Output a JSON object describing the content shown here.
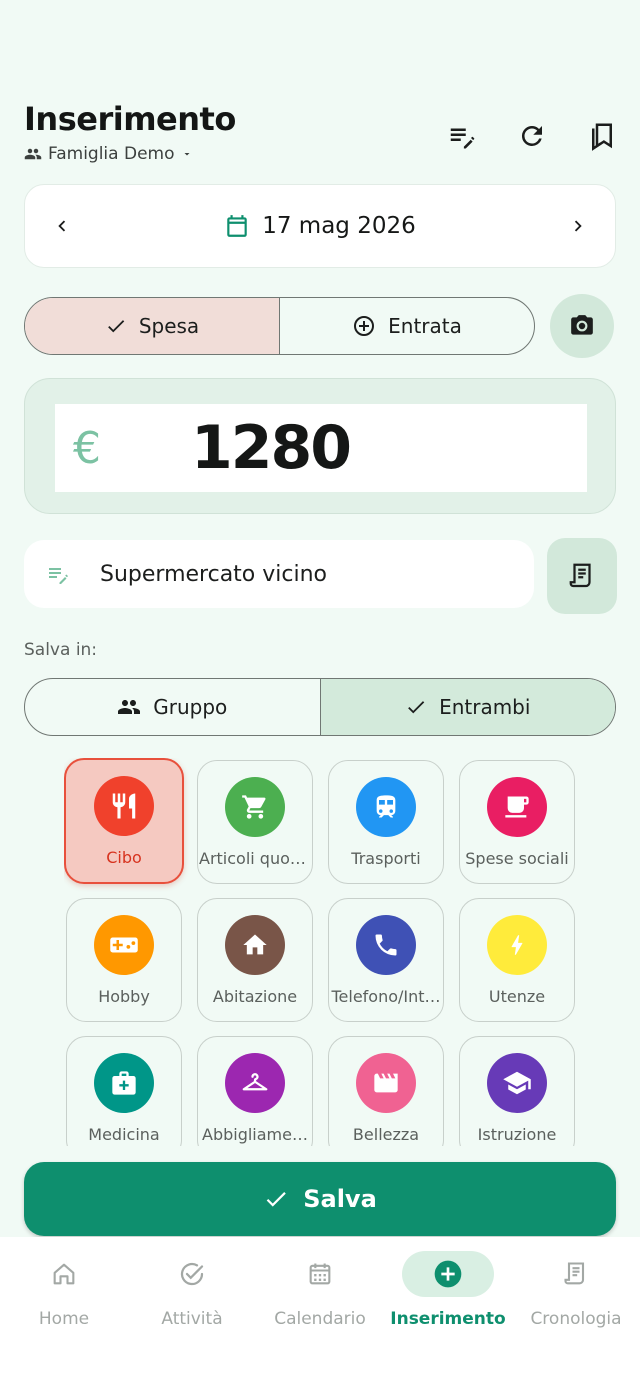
{
  "header": {
    "title": "Inserimento",
    "group_name": "Famiglia Demo"
  },
  "date_selector": {
    "date": "17 mag 2026"
  },
  "type_toggle": {
    "expense_label": "Spesa",
    "income_label": "Entrata",
    "selected": "Spesa"
  },
  "amount": {
    "currency": "€",
    "value": "1280"
  },
  "note": {
    "value": "Supermercato vicino"
  },
  "save_in": {
    "label": "Salva in:",
    "group_label": "Gruppo",
    "both_label": "Entrambi",
    "selected": "Entrambi"
  },
  "categories": [
    {
      "label": "Cibo",
      "icon": "restaurant-icon",
      "color": "#f0412c",
      "selected": true
    },
    {
      "label": "Articoli quot…",
      "icon": "cart-icon",
      "color": "#4caf50"
    },
    {
      "label": "Trasporti",
      "icon": "train-icon",
      "color": "#2196f3"
    },
    {
      "label": "Spese sociali",
      "icon": "coffee-icon",
      "color": "#e91e63"
    },
    {
      "label": "Hobby",
      "icon": "gamepad-icon",
      "color": "#ff9800"
    },
    {
      "label": "Abitazione",
      "icon": "home-icon",
      "color": "#795548"
    },
    {
      "label": "Telefono/Int…",
      "icon": "phone-icon",
      "color": "#3f51b5"
    },
    {
      "label": "Utenze",
      "icon": "bolt-icon",
      "color": "#ffeb3b"
    },
    {
      "label": "Medicina",
      "icon": "medical-kit-icon",
      "color": "#009688"
    },
    {
      "label": "Abbigliame…",
      "icon": "hanger-icon",
      "color": "#9c27b0"
    },
    {
      "label": "Bellezza",
      "icon": "clapperboard-icon",
      "color": "#f06292"
    },
    {
      "label": "Istruzione",
      "icon": "graduation-cap-icon",
      "color": "#673ab7"
    }
  ],
  "save_button": {
    "label": "Salva"
  },
  "nav": {
    "items": [
      {
        "label": "Home",
        "icon": "home-icon"
      },
      {
        "label": "Attività",
        "icon": "check-circle-icon"
      },
      {
        "label": "Calendario",
        "icon": "calendar-icon"
      },
      {
        "label": "Inserimento",
        "icon": "add-circle-icon",
        "active": true
      },
      {
        "label": "Cronologia",
        "icon": "receipt-icon"
      }
    ]
  },
  "colors": {
    "primary": "#0e8f6e",
    "background": "#f1faf5",
    "selected_expense": "#f1ddd8",
    "selected_category_border": "#e8503c"
  }
}
